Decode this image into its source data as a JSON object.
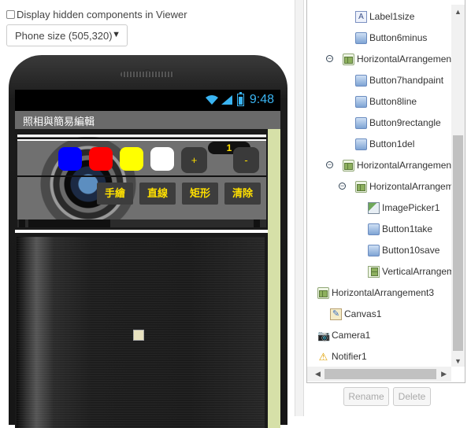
{
  "viewer": {
    "hidden_components_label": "Display hidden components in Viewer",
    "phone_size": "Phone size (505,320)"
  },
  "phone": {
    "status_time": "9:48",
    "app_title": "照相與簡易編輯",
    "colors": [
      "#0000ff",
      "#ff0000",
      "#ffff00",
      "#ffffff"
    ],
    "plus_label": "+",
    "minus_label": "-",
    "size_value": "1",
    "buttons": [
      "手繪",
      "直線",
      "矩形",
      "清除"
    ]
  },
  "tree": {
    "items": [
      {
        "label": "Label1size",
        "icon": "label-icon"
      },
      {
        "label": "Button6minus",
        "icon": "button-icon"
      },
      {
        "label": "HorizontalArrangement",
        "icon": "horizontal-arrangement-icon"
      },
      {
        "label": "Button7handpaint",
        "icon": "button-icon"
      },
      {
        "label": "Button8line",
        "icon": "button-icon"
      },
      {
        "label": "Button9rectangle",
        "icon": "button-icon"
      },
      {
        "label": "Button1del",
        "icon": "button-icon"
      },
      {
        "label": "HorizontalArrangement",
        "icon": "horizontal-arrangement-icon"
      },
      {
        "label": "HorizontalArrangement",
        "icon": "horizontal-arrangement-icon"
      },
      {
        "label": "ImagePicker1",
        "icon": "image-picker-icon"
      },
      {
        "label": "Button1take",
        "icon": "button-icon"
      },
      {
        "label": "Button10save",
        "icon": "button-icon"
      },
      {
        "label": "VerticalArrangement",
        "icon": "vertical-arrangement-icon"
      },
      {
        "label": "HorizontalArrangement3",
        "icon": "horizontal-arrangement-icon"
      },
      {
        "label": "Canvas1",
        "icon": "canvas-icon"
      },
      {
        "label": "Camera1",
        "icon": "camera-icon"
      },
      {
        "label": "Notifier1",
        "icon": "notifier-icon"
      }
    ],
    "toggle_symbol": "−",
    "rename_label": "Rename",
    "delete_label": "Delete"
  },
  "accent_colors": {
    "status_blue": "#3ab4f2",
    "button_text_yellow": "#ffe000",
    "title_gray": "#6a6a6a"
  }
}
